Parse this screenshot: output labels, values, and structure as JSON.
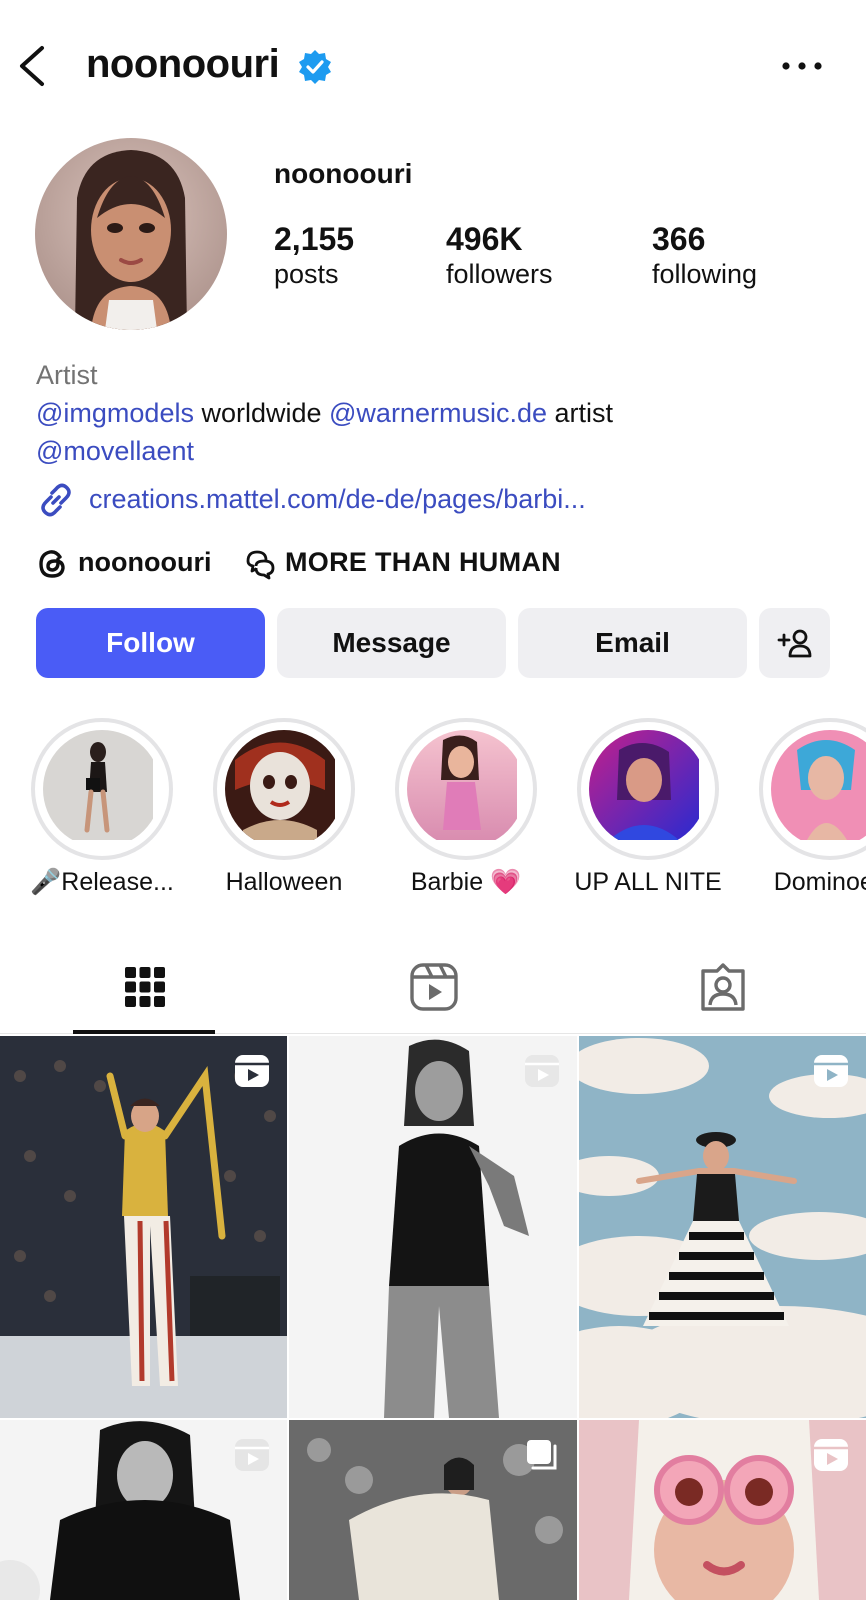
{
  "header": {
    "title": "noonoouri",
    "back_icon": "chevron-left-icon",
    "verified_icon": "verified-badge-icon",
    "more_icon": "more-horizontal-icon"
  },
  "profile": {
    "username": "noonoouri",
    "stats": [
      {
        "value": "2,155",
        "label": "posts"
      },
      {
        "value": "496K",
        "label": "followers"
      },
      {
        "value": "366",
        "label": "following"
      }
    ],
    "category": "Artist",
    "bio": {
      "mention1": "@imgmodels",
      "text1": " worldwide ",
      "mention2": "@warnermusic.de",
      "text2": " artist",
      "mention3": "@movellaent"
    },
    "link": "creations.mattel.com/de-de/pages/barbi...",
    "threads_handle": "noonoouri",
    "channel_name": "MORE THAN HUMAN"
  },
  "actions": {
    "follow": "Follow",
    "message": "Message",
    "email": "Email",
    "add_user_icon": "add-person-icon"
  },
  "highlights": [
    {
      "label": "🎤Release..."
    },
    {
      "label": "Halloween"
    },
    {
      "label": "Barbie 💗"
    },
    {
      "label": "UP ALL NITE"
    },
    {
      "label": "Dominoes"
    }
  ],
  "tabs": [
    {
      "icon": "grid-icon",
      "active": true
    },
    {
      "icon": "reels-icon",
      "active": false
    },
    {
      "icon": "tagged-icon",
      "active": false
    }
  ],
  "colors": {
    "accent": "#4a5cf6",
    "link": "#3b4cc0",
    "verified": "#1d9bf0"
  }
}
